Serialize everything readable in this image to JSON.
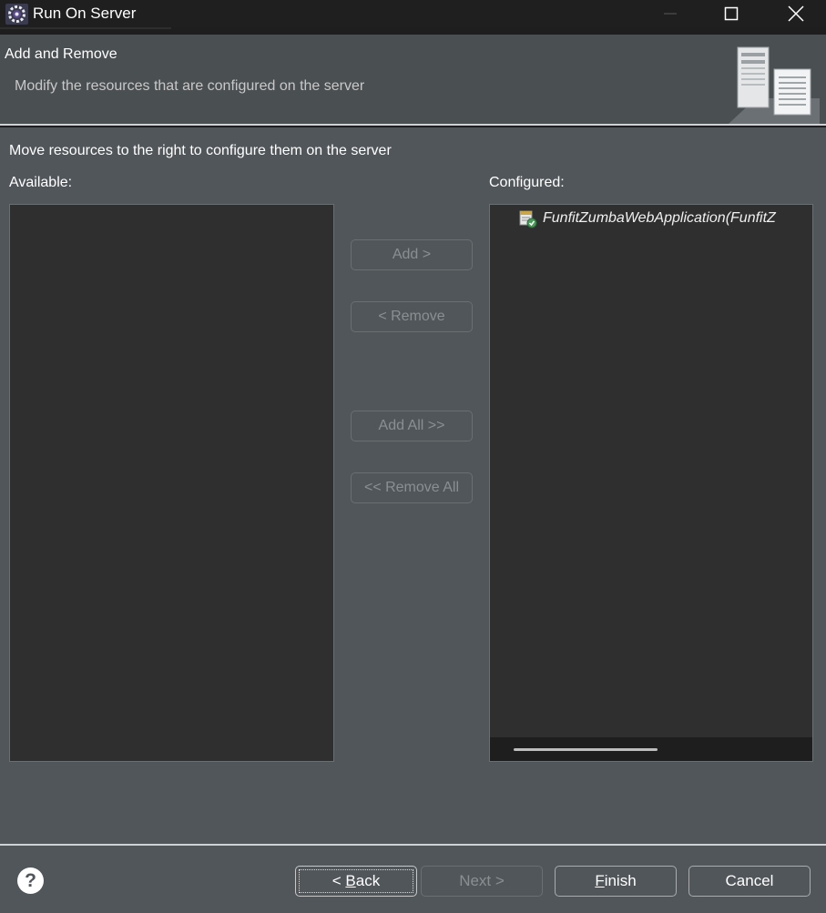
{
  "window": {
    "title": "Run On Server",
    "icon": "eclipse-gear-icon"
  },
  "header": {
    "title": "Add and Remove",
    "description": "Modify the resources that are configured on the server",
    "icon": "server-documents-icon"
  },
  "main": {
    "instruction": "Move resources to the right to configure them on the server",
    "available_label": "Available:",
    "configured_label": "Configured:",
    "available_items": [],
    "configured_items": [
      {
        "label": "FunfitZumbaWebApplication(FunfitZ",
        "icon": "web-module-icon"
      }
    ],
    "buttons": {
      "add": "Add >",
      "remove": "< Remove",
      "add_all": "Add All >>",
      "remove_all": "<< Remove All"
    }
  },
  "footer": {
    "help": "?",
    "back": {
      "prefix": "< ",
      "mnemonic": "B",
      "rest": "ack"
    },
    "next": "Next >",
    "finish": {
      "mnemonic": "F",
      "rest": "inish"
    },
    "cancel": "Cancel"
  }
}
